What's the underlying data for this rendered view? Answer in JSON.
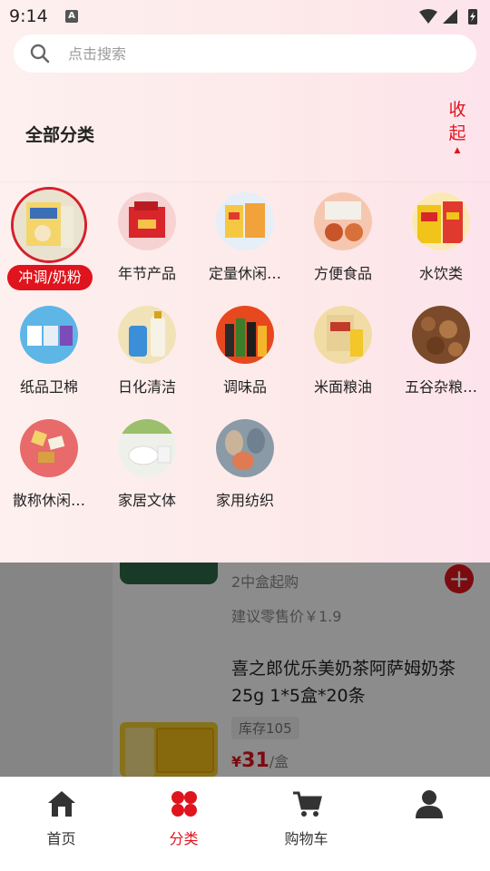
{
  "status_bar": {
    "time": "9:14",
    "notification_badge": "A"
  },
  "search": {
    "placeholder": "点击搜索"
  },
  "header": {
    "title": "全部分类",
    "collapse_label": "收起"
  },
  "categories": [
    {
      "label": "冲调/奶粉",
      "selected": true
    },
    {
      "label": "年节产品"
    },
    {
      "label": "定量休闲…"
    },
    {
      "label": "方便食品"
    },
    {
      "label": "水饮类"
    },
    {
      "label": "纸品卫棉"
    },
    {
      "label": "日化清洁"
    },
    {
      "label": "调味品"
    },
    {
      "label": "米面粮油"
    },
    {
      "label": "五谷杂粮…"
    },
    {
      "label": "散称休闲…"
    },
    {
      "label": "家居文体"
    },
    {
      "label": "家用纺织"
    }
  ],
  "background_products": {
    "item1": {
      "min_order": "2中盒起购",
      "retail_price": "建议零售价￥1.9"
    },
    "item2": {
      "title": "喜之郎优乐美奶茶阿萨姆奶茶25g 1*5盒*20条",
      "stock": "库存105",
      "currency": "¥",
      "price": "31",
      "unit": "/盒"
    }
  },
  "tabs": [
    {
      "label": "首页"
    },
    {
      "label": "分类",
      "active": true
    },
    {
      "label": "购物车"
    },
    {
      "label": ""
    }
  ],
  "colors": {
    "accent": "#e0141d",
    "panel_bg": "#fde9e9"
  }
}
